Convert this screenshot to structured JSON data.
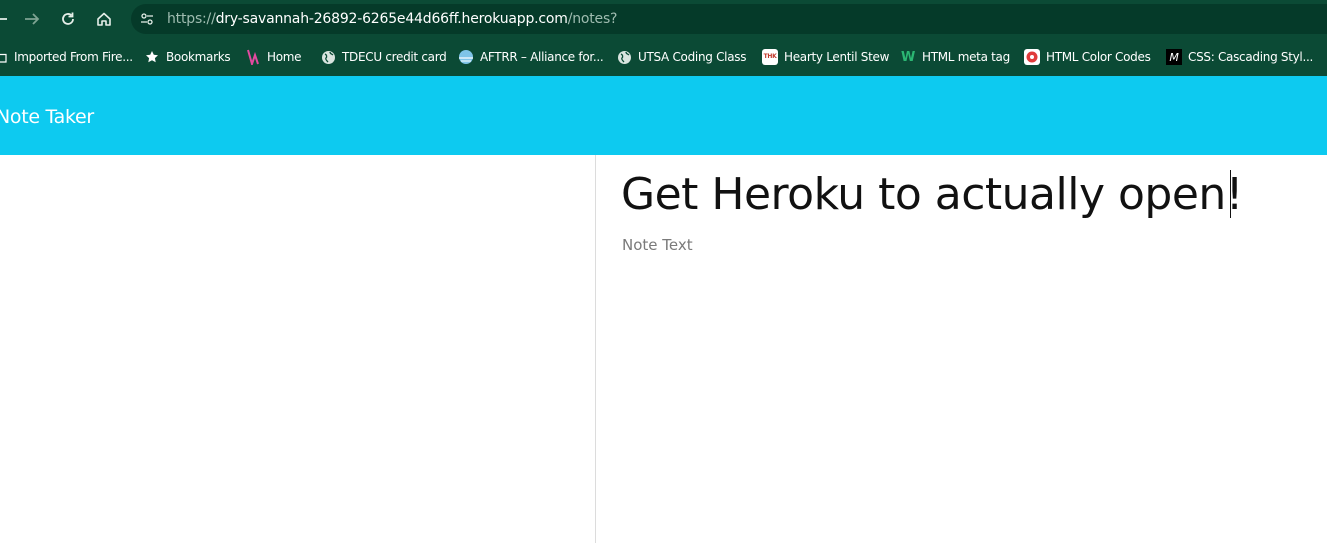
{
  "browser": {
    "url_scheme": "https://",
    "url_host": "dry-savannah-26892-6265e44d66ff.herokuapp.com",
    "url_path": "/notes?"
  },
  "bookmarks": [
    {
      "label": "Imported From Fire...",
      "icon": "folder-icon"
    },
    {
      "label": "Bookmarks",
      "icon": "star-icon"
    },
    {
      "label": "Home",
      "icon": "home-logo-icon"
    },
    {
      "label": "TDECU credit card",
      "icon": "globe-icon"
    },
    {
      "label": "AFTRR – Alliance for...",
      "icon": "aftrr-logo-icon"
    },
    {
      "label": "UTSA Coding Class",
      "icon": "globe-icon"
    },
    {
      "label": "Hearty Lentil Stew",
      "icon": "thk-logo-icon",
      "icon_text": "THK"
    },
    {
      "label": "HTML meta tag",
      "icon": "w-logo-icon",
      "icon_text": "W"
    },
    {
      "label": "HTML Color Codes",
      "icon": "color-wheel-icon"
    },
    {
      "label": "CSS: Cascading Styl...",
      "icon": "mdn-logo-icon",
      "icon_text": "M"
    }
  ],
  "app": {
    "brand": "Note Taker"
  },
  "note": {
    "title_value": "Get Heroku to actually open!",
    "text_placeholder": "Note Text",
    "text_value": ""
  },
  "colors": {
    "browser_chrome": "#0b4a35",
    "header": "#0dcaf0"
  }
}
